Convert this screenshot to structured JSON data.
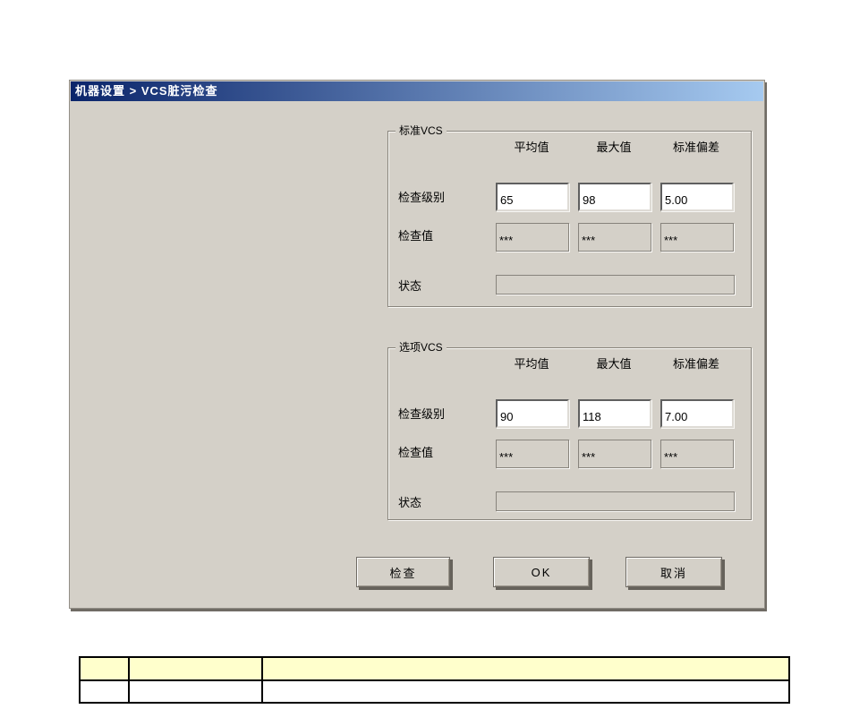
{
  "dialog": {
    "title": "机器设置 > VCS脏污检查",
    "colors": {
      "titlebar_gradient_left": "#0a246a",
      "titlebar_gradient_right": "#a6caf0",
      "dialog_bg": "#d4d0c8",
      "input_bg": "#ffffff"
    },
    "groups": [
      {
        "label": "标准VCS",
        "columns": [
          "平均值",
          "最大值",
          "标准偏差"
        ],
        "check_level": {
          "label": "检查级别",
          "values": [
            "65",
            "98",
            "5.00"
          ]
        },
        "check_value": {
          "label": "检查值",
          "values": [
            "***",
            "***",
            "***"
          ]
        },
        "status": {
          "label": "状态",
          "value": ""
        }
      },
      {
        "label": "选项VCS",
        "columns": [
          "平均值",
          "最大值",
          "标准偏差"
        ],
        "check_level": {
          "label": "检查级别",
          "values": [
            "90",
            "118",
            "7.00"
          ]
        },
        "check_value": {
          "label": "检查值",
          "values": [
            "***",
            "***",
            "***"
          ]
        },
        "status": {
          "label": "状态",
          "value": ""
        }
      }
    ],
    "buttons": {
      "check": "检查",
      "ok": "OK",
      "cancel": "取消"
    }
  },
  "bottom_table": {
    "header_bg": "#ffffcc",
    "header_cells": [
      "",
      "",
      ""
    ],
    "row_cells": [
      "",
      "",
      ""
    ]
  }
}
